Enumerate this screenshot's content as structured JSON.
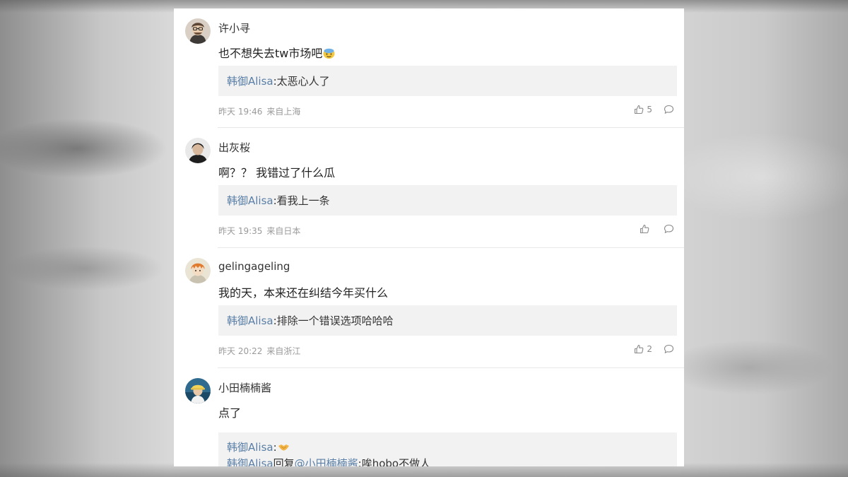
{
  "comments": [
    {
      "username": "许小寻",
      "text": "也不想失去tw市场吧",
      "text_emoji": "face-with-sweat-emoji",
      "replies": [
        {
          "author": "韩御Alisa",
          "separator": ":",
          "text": "太恶心人了"
        }
      ],
      "time": "昨天 19:46",
      "location": "来自上海",
      "likes": "5"
    },
    {
      "username": "出灰桜",
      "text": "啊？？ 我错过了什么瓜",
      "replies": [
        {
          "author": "韩御Alisa",
          "separator": ":",
          "text": "看我上一条"
        }
      ],
      "time": "昨天 19:35",
      "location": "来自日本",
      "likes": ""
    },
    {
      "username": "gelingageling",
      "text": "我的天，本来还在纠结今年买什么",
      "replies": [
        {
          "author": "韩御Alisa",
          "separator": ":",
          "text": "排除一个错误选项哈哈哈"
        }
      ],
      "time": "昨天 20:22",
      "location": "来自浙江",
      "likes": "2"
    },
    {
      "username": "小田楠楠酱",
      "text": "点了",
      "replies": [
        {
          "author": "韩御Alisa",
          "separator": ":",
          "text": "",
          "emoji": "handshake-emoji"
        },
        {
          "author": "韩御Alisa",
          "mid": "回复",
          "mention": "@小田楠楠酱",
          "separator": ":",
          "text": "唉hobo不做人"
        }
      ]
    }
  ],
  "icons": {
    "like": "thumbs-up-icon",
    "comment": "comment-bubble-icon"
  },
  "colors": {
    "link": "#5a7fa6",
    "reply_bg": "#f2f2f2",
    "meta": "#9a9a9a"
  }
}
